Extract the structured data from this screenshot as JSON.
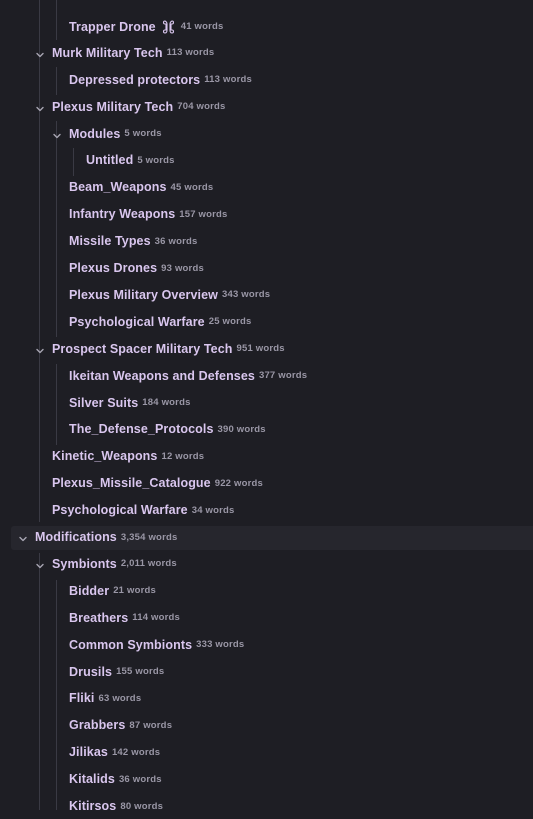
{
  "colors": {
    "background": "#1e1e24",
    "label": "#d9c6ee",
    "count": "#9a97a6",
    "guide": "#3a3a44",
    "chevron": "#a8a6b3",
    "selected_row": "#26262d"
  },
  "tree": [
    {
      "label": "",
      "count": "",
      "depth": 2,
      "chevron": false,
      "partial": true
    },
    {
      "label": "Trapper Drone",
      "count": "41 words",
      "depth": 2,
      "chevron": false,
      "icon": "command-icon"
    },
    {
      "label": "Murk Military Tech",
      "count": "113 words",
      "depth": 1,
      "chevron": true
    },
    {
      "label": "Depressed protectors",
      "count": "113 words",
      "depth": 2,
      "chevron": false
    },
    {
      "label": "Plexus Military Tech",
      "count": "704 words",
      "depth": 1,
      "chevron": true
    },
    {
      "label": "Modules",
      "count": "5 words",
      "depth": 2,
      "chevron": true
    },
    {
      "label": "Untitled",
      "count": "5 words",
      "depth": 3,
      "chevron": false
    },
    {
      "label": "Beam_Weapons",
      "count": "45 words",
      "depth": 2,
      "chevron": false
    },
    {
      "label": "Infantry Weapons",
      "count": "157 words",
      "depth": 2,
      "chevron": false
    },
    {
      "label": "Missile Types",
      "count": "36 words",
      "depth": 2,
      "chevron": false
    },
    {
      "label": "Plexus Drones",
      "count": "93 words",
      "depth": 2,
      "chevron": false
    },
    {
      "label": "Plexus Military Overview",
      "count": "343 words",
      "depth": 2,
      "chevron": false
    },
    {
      "label": "Psychological Warfare",
      "count": "25 words",
      "depth": 2,
      "chevron": false
    },
    {
      "label": "Prospect Spacer Military Tech",
      "count": "951 words",
      "depth": 1,
      "chevron": true
    },
    {
      "label": "Ikeitan Weapons and Defenses",
      "count": "377 words",
      "depth": 2,
      "chevron": false
    },
    {
      "label": "Silver Suits",
      "count": "184 words",
      "depth": 2,
      "chevron": false
    },
    {
      "label": "The_Defense_Protocols",
      "count": "390 words",
      "depth": 2,
      "chevron": false
    },
    {
      "label": "Kinetic_Weapons",
      "count": "12 words",
      "depth": 1,
      "chevron": false
    },
    {
      "label": "Plexus_Missile_Catalogue",
      "count": "922 words",
      "depth": 1,
      "chevron": false
    },
    {
      "label": "Psychological Warfare",
      "count": "34 words",
      "depth": 1,
      "chevron": false
    },
    {
      "label": "Modifications",
      "count": "3,354 words",
      "depth": 0,
      "chevron": true,
      "selected": true
    },
    {
      "label": "Symbionts",
      "count": "2,011 words",
      "depth": 1,
      "chevron": true
    },
    {
      "label": "Bidder",
      "count": "21 words",
      "depth": 2,
      "chevron": false
    },
    {
      "label": "Breathers",
      "count": "114 words",
      "depth": 2,
      "chevron": false
    },
    {
      "label": "Common Symbionts",
      "count": "333 words",
      "depth": 2,
      "chevron": false
    },
    {
      "label": "Drusils",
      "count": "155 words",
      "depth": 2,
      "chevron": false
    },
    {
      "label": "Fliki",
      "count": "63 words",
      "depth": 2,
      "chevron": false
    },
    {
      "label": "Grabbers",
      "count": "87 words",
      "depth": 2,
      "chevron": false
    },
    {
      "label": "Jilikas",
      "count": "142 words",
      "depth": 2,
      "chevron": false
    },
    {
      "label": "Kitalids",
      "count": "36 words",
      "depth": 2,
      "chevron": false
    },
    {
      "label": "Kitirsos",
      "count": "80 words",
      "depth": 2,
      "chevron": false,
      "partial": true
    }
  ]
}
